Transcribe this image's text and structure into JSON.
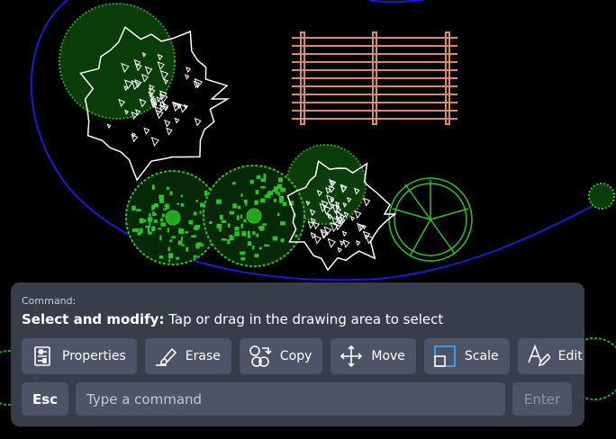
{
  "colors": {
    "background": "#000000",
    "boundary_line": "#1a1ad6",
    "tree_outline_white": "#ffffff",
    "shrub_green": "#1fa81f",
    "fence_salmon": "#d98a6e",
    "panel_bg": "#3b414f",
    "button_bg": "#4d5466"
  },
  "command_panel": {
    "label": "Command:",
    "prompt_bold": "Select and modify:",
    "prompt_text": " Tap or drag in the drawing area to select",
    "toolbar": [
      {
        "id": "properties",
        "label": "Properties",
        "icon": "properties-icon"
      },
      {
        "id": "erase",
        "label": "Erase",
        "icon": "eraser-icon"
      },
      {
        "id": "copy",
        "label": "Copy",
        "icon": "copy-icon"
      },
      {
        "id": "move",
        "label": "Move",
        "icon": "move-arrows-icon"
      },
      {
        "id": "scale",
        "label": "Scale",
        "icon": "scale-icon"
      },
      {
        "id": "edit",
        "label": "Edit",
        "icon": "text-edit-icon"
      }
    ],
    "esc_label": "Esc",
    "input_placeholder": "Type a command",
    "enter_label": "Enter"
  }
}
